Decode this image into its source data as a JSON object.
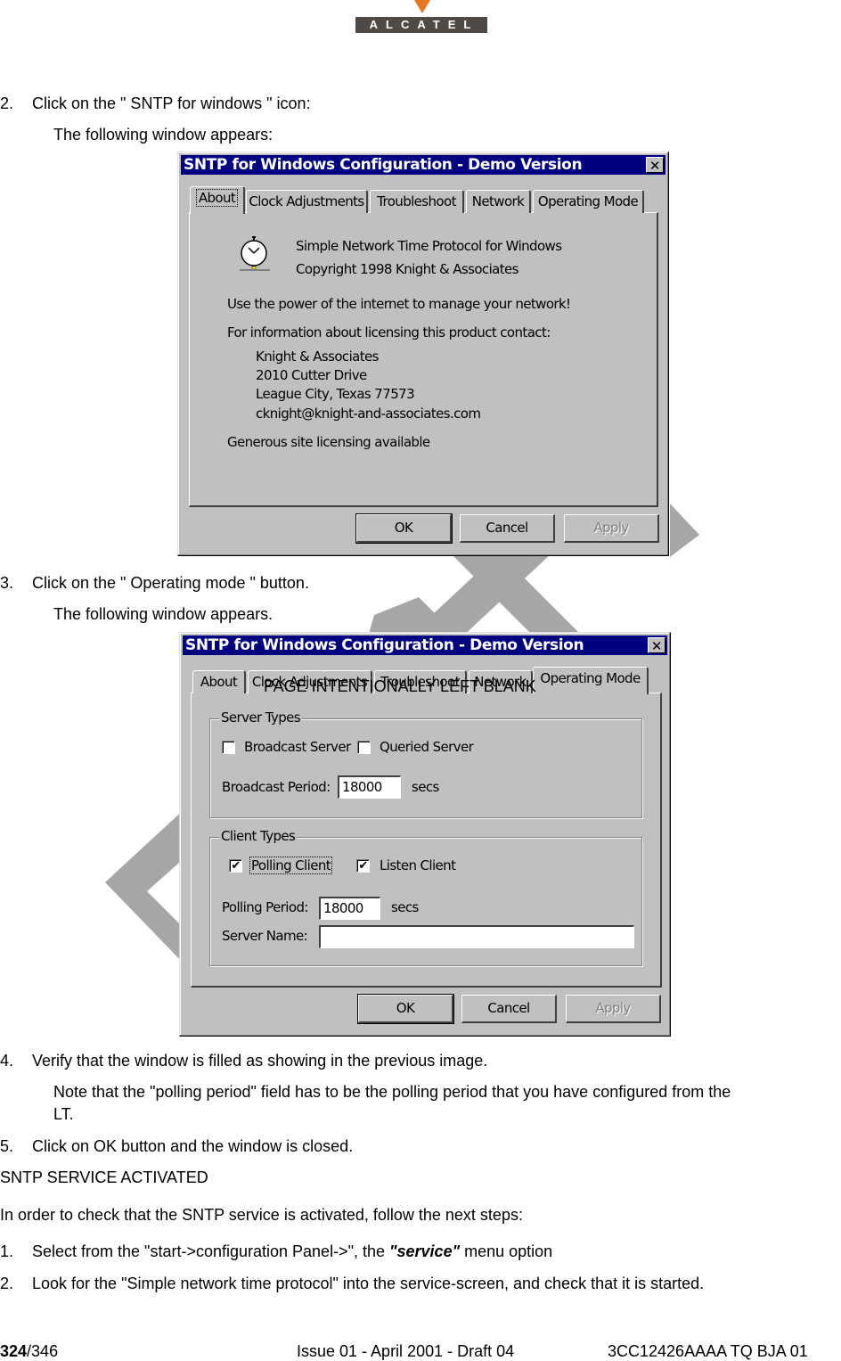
{
  "logo": {
    "text": "ALCATEL",
    "arrow_color": "#e87722",
    "bar_color": "#4f4a46"
  },
  "steps_top": [
    {
      "number": "2.",
      "text": "Click on the \" SNTP for windows \" icon:",
      "sub": "The following window appears:"
    },
    {
      "number": "3.",
      "text": "Click on the \" Operating mode \" button.",
      "sub": "The following window appears."
    }
  ],
  "dialog_about": {
    "title": "SNTP for Windows Configuration - Demo Version",
    "close_icon": "close-icon",
    "tabs": [
      "About",
      "Clock Adjustments",
      "Troubleshoot",
      "Network",
      "Operating Mode"
    ],
    "active_tab": "About",
    "product_name": "Simple Network Time Protocol for Windows",
    "copyright": "Copyright 1998 Knight & Associates",
    "tagline": "Use the power of the internet to manage your network!",
    "licensing_intro": "For information about licensing this product contact:",
    "contact": [
      "Knight & Associates",
      "2010 Cutter Drive",
      "League City, Texas 77573",
      "cknight@knight-and-associates.com"
    ],
    "licensing_note": "Generous site licensing available",
    "buttons": {
      "ok": "OK",
      "cancel": "Cancel",
      "apply": "Apply"
    }
  },
  "dialog_operating": {
    "title": "SNTP for Windows Configuration - Demo Version",
    "tabs": [
      "About",
      "Clock Adjustments",
      "Troubleshoot",
      "Network",
      "Operating Mode"
    ],
    "active_tab": "Operating Mode",
    "overlay_text": "PAGE INTENTIONALLY LEFT BLANK",
    "server_types": {
      "label": "Server Types",
      "broadcast_server": {
        "label": "Broadcast Server",
        "checked": false
      },
      "queried_server": {
        "label": "Queried Server",
        "checked": false
      },
      "broadcast_period_label": "Broadcast Period:",
      "broadcast_period_value": "18000",
      "unit": "secs"
    },
    "client_types": {
      "label": "Client Types",
      "polling_client": {
        "label": "Polling Client",
        "checked": true
      },
      "listen_client": {
        "label": "Listen Client",
        "checked": true
      },
      "polling_period_label": "Polling Period:",
      "polling_period_value": "18000",
      "unit": "secs",
      "server_name_label": "Server Name:",
      "server_name_value": ""
    },
    "check_mark": "✔",
    "buttons": {
      "ok": "OK",
      "cancel": "Cancel",
      "apply": "Apply"
    }
  },
  "steps_bottom": {
    "step4": {
      "number": "4.",
      "text": "Verify that the window is filled as showing in the previous image."
    },
    "note_line1": "Note that the \"polling period\" field has to be the polling period that you have configured from the",
    "note_line2": "LT.",
    "step5": {
      "number": "5.",
      "text": "Click on OK button and the window is closed."
    },
    "section_heading": "SNTP SERVICE ACTIVATED",
    "intro": "In order to check that the SNTP service is activated, follow the next steps:",
    "sub1": {
      "number": "1.",
      "text_before": "Select from the \"start->configuration Panel->\", the ",
      "emphasis": "\"service\"",
      "text_after": " menu option"
    },
    "sub2": {
      "number": "2.",
      "text": "Look for the \"Simple network time protocol\" into the service-screen, and check that it is started."
    }
  },
  "footer": {
    "page_current": "324",
    "page_total": "/346",
    "issue": "Issue 01 - April 2001 - Draft 04",
    "doc_ref": "3CC12426AAAA TQ BJA 01"
  }
}
